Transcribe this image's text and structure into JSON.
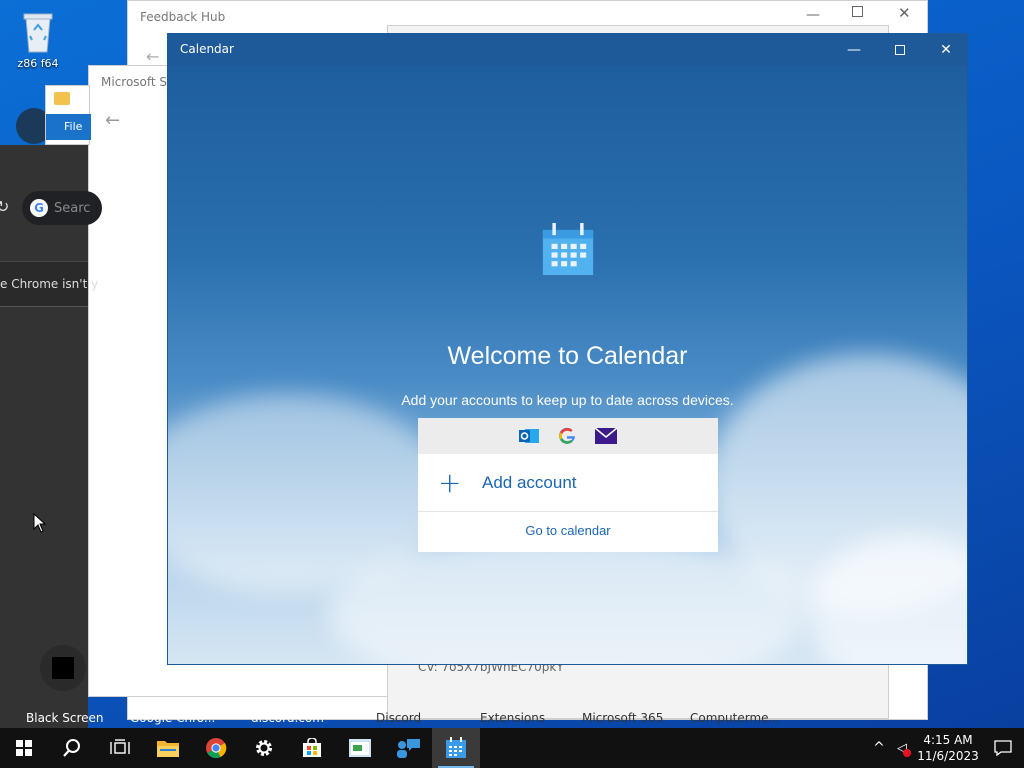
{
  "desktop": {
    "recycle_label": "z86 f64",
    "bottom_labels": [
      "Black Screen",
      "Google Chro...",
      "discord.com",
      "Discord",
      "Extensions",
      "Microsoft 365",
      "Computerme..."
    ],
    "bg_text": "CV: 7o5X7bJWhEC70pkY"
  },
  "feedback_window": {
    "title": "Feedback Hub"
  },
  "store_window": {
    "title": "Microsoft Sto"
  },
  "explorer_window": {
    "file_tab": "File"
  },
  "chrome_window": {
    "search_placeholder": "Searc",
    "notice": "e Chrome isn't y"
  },
  "calendar": {
    "window_title": "Calendar",
    "welcome": "Welcome to Calendar",
    "subtitle": "Add your accounts to keep up to date across devices.",
    "add_account": "Add account",
    "go_to_calendar": "Go to calendar",
    "accent": "#1a66b5"
  },
  "taskbar": {
    "time": "4:15 AM",
    "date": "11/6/2023"
  }
}
